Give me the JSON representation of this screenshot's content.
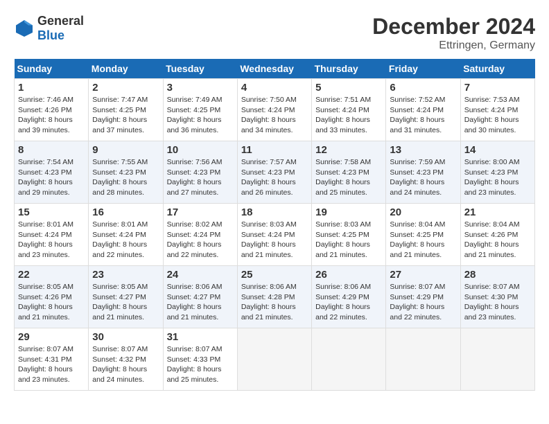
{
  "header": {
    "logo_general": "General",
    "logo_blue": "Blue",
    "month": "December 2024",
    "location": "Ettringen, Germany"
  },
  "days_of_week": [
    "Sunday",
    "Monday",
    "Tuesday",
    "Wednesday",
    "Thursday",
    "Friday",
    "Saturday"
  ],
  "weeks": [
    [
      {
        "day": "1",
        "sunrise": "7:46 AM",
        "sunset": "4:26 PM",
        "daylight": "8 hours and 39 minutes."
      },
      {
        "day": "2",
        "sunrise": "7:47 AM",
        "sunset": "4:25 PM",
        "daylight": "8 hours and 37 minutes."
      },
      {
        "day": "3",
        "sunrise": "7:49 AM",
        "sunset": "4:25 PM",
        "daylight": "8 hours and 36 minutes."
      },
      {
        "day": "4",
        "sunrise": "7:50 AM",
        "sunset": "4:24 PM",
        "daylight": "8 hours and 34 minutes."
      },
      {
        "day": "5",
        "sunrise": "7:51 AM",
        "sunset": "4:24 PM",
        "daylight": "8 hours and 33 minutes."
      },
      {
        "day": "6",
        "sunrise": "7:52 AM",
        "sunset": "4:24 PM",
        "daylight": "8 hours and 31 minutes."
      },
      {
        "day": "7",
        "sunrise": "7:53 AM",
        "sunset": "4:24 PM",
        "daylight": "8 hours and 30 minutes."
      }
    ],
    [
      {
        "day": "8",
        "sunrise": "7:54 AM",
        "sunset": "4:23 PM",
        "daylight": "8 hours and 29 minutes."
      },
      {
        "day": "9",
        "sunrise": "7:55 AM",
        "sunset": "4:23 PM",
        "daylight": "8 hours and 28 minutes."
      },
      {
        "day": "10",
        "sunrise": "7:56 AM",
        "sunset": "4:23 PM",
        "daylight": "8 hours and 27 minutes."
      },
      {
        "day": "11",
        "sunrise": "7:57 AM",
        "sunset": "4:23 PM",
        "daylight": "8 hours and 26 minutes."
      },
      {
        "day": "12",
        "sunrise": "7:58 AM",
        "sunset": "4:23 PM",
        "daylight": "8 hours and 25 minutes."
      },
      {
        "day": "13",
        "sunrise": "7:59 AM",
        "sunset": "4:23 PM",
        "daylight": "8 hours and 24 minutes."
      },
      {
        "day": "14",
        "sunrise": "8:00 AM",
        "sunset": "4:23 PM",
        "daylight": "8 hours and 23 minutes."
      }
    ],
    [
      {
        "day": "15",
        "sunrise": "8:01 AM",
        "sunset": "4:24 PM",
        "daylight": "8 hours and 23 minutes."
      },
      {
        "day": "16",
        "sunrise": "8:01 AM",
        "sunset": "4:24 PM",
        "daylight": "8 hours and 22 minutes."
      },
      {
        "day": "17",
        "sunrise": "8:02 AM",
        "sunset": "4:24 PM",
        "daylight": "8 hours and 22 minutes."
      },
      {
        "day": "18",
        "sunrise": "8:03 AM",
        "sunset": "4:24 PM",
        "daylight": "8 hours and 21 minutes."
      },
      {
        "day": "19",
        "sunrise": "8:03 AM",
        "sunset": "4:25 PM",
        "daylight": "8 hours and 21 minutes."
      },
      {
        "day": "20",
        "sunrise": "8:04 AM",
        "sunset": "4:25 PM",
        "daylight": "8 hours and 21 minutes."
      },
      {
        "day": "21",
        "sunrise": "8:04 AM",
        "sunset": "4:26 PM",
        "daylight": "8 hours and 21 minutes."
      }
    ],
    [
      {
        "day": "22",
        "sunrise": "8:05 AM",
        "sunset": "4:26 PM",
        "daylight": "8 hours and 21 minutes."
      },
      {
        "day": "23",
        "sunrise": "8:05 AM",
        "sunset": "4:27 PM",
        "daylight": "8 hours and 21 minutes."
      },
      {
        "day": "24",
        "sunrise": "8:06 AM",
        "sunset": "4:27 PM",
        "daylight": "8 hours and 21 minutes."
      },
      {
        "day": "25",
        "sunrise": "8:06 AM",
        "sunset": "4:28 PM",
        "daylight": "8 hours and 21 minutes."
      },
      {
        "day": "26",
        "sunrise": "8:06 AM",
        "sunset": "4:29 PM",
        "daylight": "8 hours and 22 minutes."
      },
      {
        "day": "27",
        "sunrise": "8:07 AM",
        "sunset": "4:29 PM",
        "daylight": "8 hours and 22 minutes."
      },
      {
        "day": "28",
        "sunrise": "8:07 AM",
        "sunset": "4:30 PM",
        "daylight": "8 hours and 23 minutes."
      }
    ],
    [
      {
        "day": "29",
        "sunrise": "8:07 AM",
        "sunset": "4:31 PM",
        "daylight": "8 hours and 23 minutes."
      },
      {
        "day": "30",
        "sunrise": "8:07 AM",
        "sunset": "4:32 PM",
        "daylight": "8 hours and 24 minutes."
      },
      {
        "day": "31",
        "sunrise": "8:07 AM",
        "sunset": "4:33 PM",
        "daylight": "8 hours and 25 minutes."
      },
      null,
      null,
      null,
      null
    ]
  ]
}
